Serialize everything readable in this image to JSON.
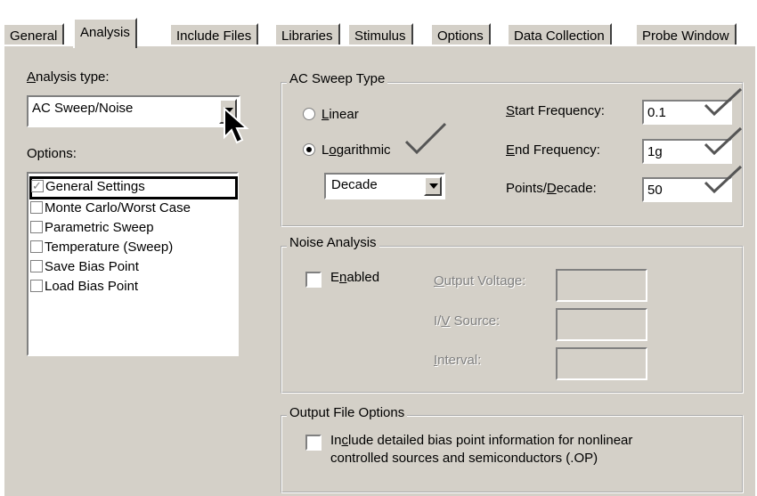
{
  "tabs": [
    "General",
    "Analysis",
    "Include Files",
    "Libraries",
    "Stimulus",
    "Options",
    "Data Collection",
    "Probe Window"
  ],
  "active_tab": "Analysis",
  "analysis": {
    "type_label": "Analysis type:",
    "type_value": "AC Sweep/Noise",
    "options_label": "Options:",
    "options": [
      {
        "label": "General Settings",
        "checked": true
      },
      {
        "label": "Monte Carlo/Worst Case",
        "checked": false
      },
      {
        "label": "Parametric Sweep",
        "checked": false
      },
      {
        "label": "Temperature (Sweep)",
        "checked": false
      },
      {
        "label": "Save Bias Point",
        "checked": false
      },
      {
        "label": "Load Bias Point",
        "checked": false
      }
    ]
  },
  "ac_sweep": {
    "title": "AC Sweep Type",
    "linear_label": "Linear",
    "log_label": "Logarithmic",
    "selected": "Logarithmic",
    "log_mode": "Decade",
    "start_label": "Start Frequency:",
    "start_value": "0.1",
    "end_label": "End Frequency:",
    "end_value": "1g",
    "points_label": "Points/Decade:",
    "points_value": "50"
  },
  "noise": {
    "title": "Noise Analysis",
    "enabled_label": "Enabled",
    "enabled": false,
    "output_voltage_label": "Output Voltage:",
    "iv_source_label": "I/V Source:",
    "interval_label": "Interval:"
  },
  "output": {
    "title": "Output File Options",
    "bias_label_line1": "Include detailed bias point information for nonlinear",
    "bias_label_line2": "controlled sources and semiconductors (.OP)",
    "bias_checked": false
  },
  "annotation_color": "#555555"
}
